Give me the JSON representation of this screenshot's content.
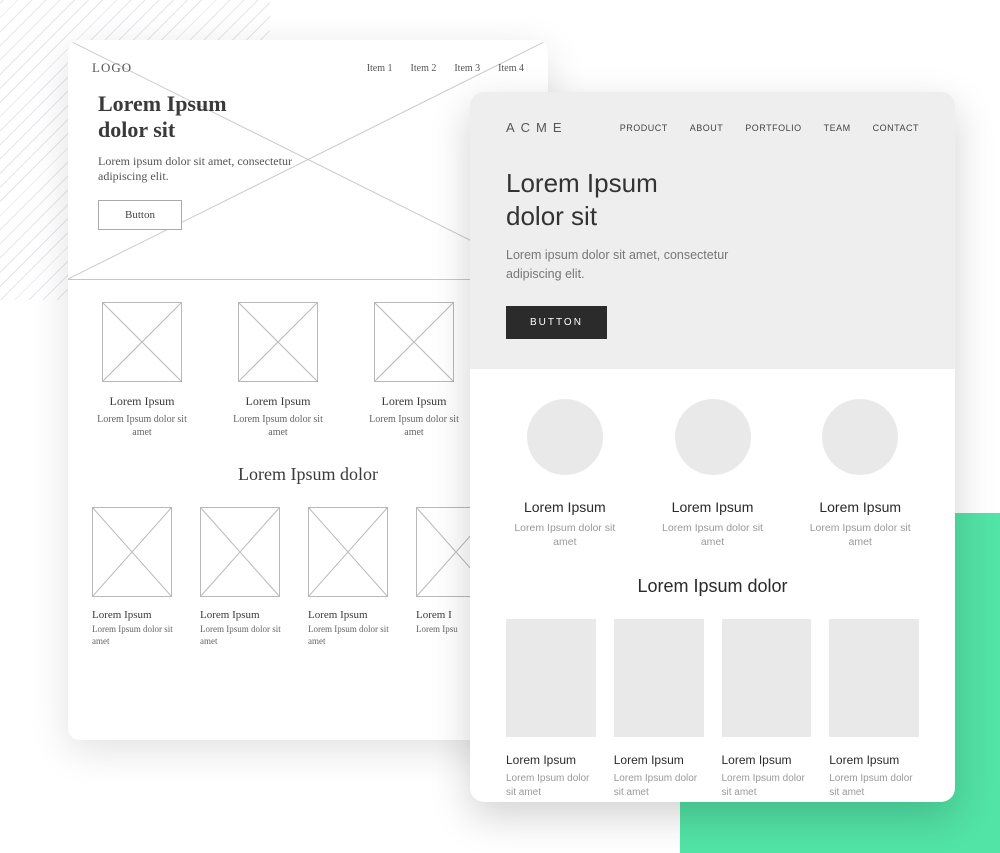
{
  "wireframe": {
    "logo": "LOGO",
    "nav": [
      "Item 1",
      "Item 2",
      "Item 3",
      "Item 4"
    ],
    "hero": {
      "title_line1": "Lorem Ipsum",
      "title_line2": "dolor sit",
      "subtitle": "Lorem ipsum dolor sit amet, consectetur adipiscing elit.",
      "button": "Button"
    },
    "features": [
      {
        "title": "Lorem Ipsum",
        "sub": "Lorem Ipsum dolor sit amet"
      },
      {
        "title": "Lorem Ipsum",
        "sub": "Lorem Ipsum dolor sit amet"
      },
      {
        "title": "Lorem Ipsum",
        "sub": "Lorem Ipsum dolor sit amet"
      }
    ],
    "section2_title": "Lorem Ipsum dolor",
    "items": [
      {
        "title": "Lorem Ipsum",
        "sub": "Lorem Ipsum dolor sit amet"
      },
      {
        "title": "Lorem Ipsum",
        "sub": "Lorem Ipsum dolor sit amet"
      },
      {
        "title": "Lorem Ipsum",
        "sub": "Lorem Ipsum dolor sit amet"
      },
      {
        "title": "Lorem I",
        "sub": "Lorem Ipsu"
      }
    ]
  },
  "mockup": {
    "logo": "ACME",
    "nav": [
      "PRODUCT",
      "ABOUT",
      "PORTFOLIO",
      "TEAM",
      "CONTACT"
    ],
    "hero": {
      "title_line1": "Lorem Ipsum",
      "title_line2": "dolor sit",
      "subtitle": "Lorem ipsum dolor sit amet, consectetur adipiscing elit.",
      "button": "BUTTON"
    },
    "features": [
      {
        "title": "Lorem Ipsum",
        "sub": "Lorem Ipsum dolor sit amet"
      },
      {
        "title": "Lorem Ipsum",
        "sub": "Lorem Ipsum dolor sit amet"
      },
      {
        "title": "Lorem Ipsum",
        "sub": "Lorem Ipsum dolor sit amet"
      }
    ],
    "section2_title": "Lorem Ipsum dolor",
    "items": [
      {
        "title": "Lorem Ipsum",
        "sub": "Lorem Ipsum dolor sit amet"
      },
      {
        "title": "Lorem Ipsum",
        "sub": "Lorem Ipsum dolor sit amet"
      },
      {
        "title": "Lorem Ipsum",
        "sub": "Lorem Ipsum dolor sit amet"
      },
      {
        "title": "Lorem Ipsum",
        "sub": "Lorem Ipsum dolor sit amet"
      }
    ]
  }
}
